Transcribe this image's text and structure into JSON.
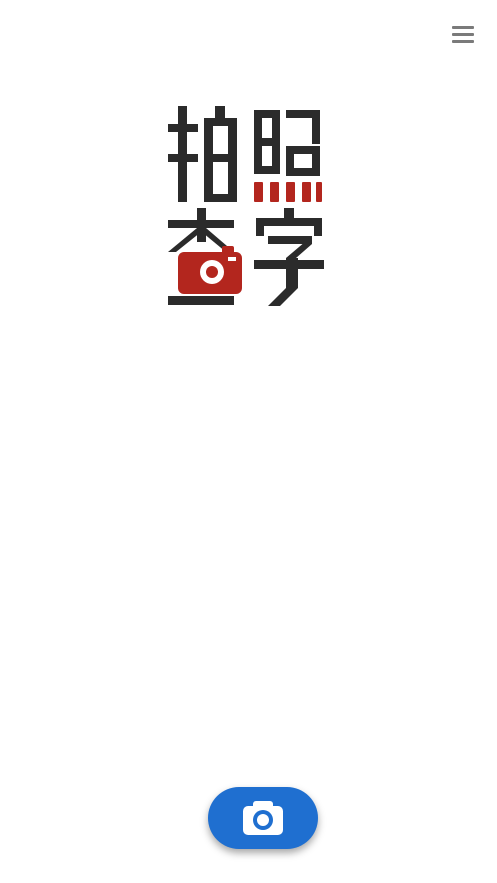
{
  "app": {
    "logo_text": "拍照查字"
  },
  "menu": {
    "icon": "hamburger-menu-icon"
  },
  "capture": {
    "icon": "camera-icon"
  },
  "colors": {
    "logo_dark": "#2b2b2b",
    "logo_red": "#b3261e",
    "button_blue": "#1f6fd0",
    "menu_gray": "#7a7a7a"
  }
}
